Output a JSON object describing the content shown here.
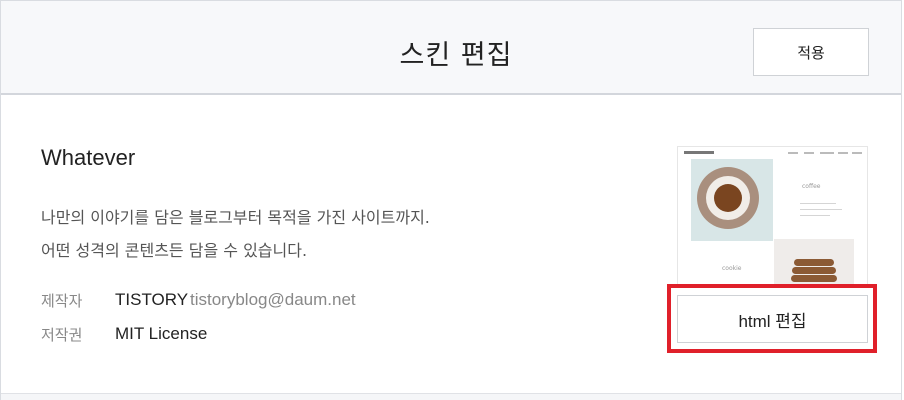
{
  "header": {
    "title": "스킨 편집",
    "apply_label": "적용"
  },
  "skin": {
    "name": "Whatever",
    "description_line1": "나만의 이야기를 담은 블로그부터 목적을 가진 사이트까지.",
    "description_line2": "어떤 성격의 콘텐츠든 담을 수 있습니다.",
    "creator_label": "제작자",
    "creator_name": "TISTORY",
    "creator_email": "tistoryblog@daum.net",
    "license_label": "저작권",
    "license_value": "MIT License"
  },
  "preview": {
    "coffee_text": "coffee",
    "cookie_text": "cookie"
  },
  "edit_html_label": "html 편집",
  "colors": {
    "highlight": "#e0202a",
    "header_bg": "#f7f8fa"
  }
}
